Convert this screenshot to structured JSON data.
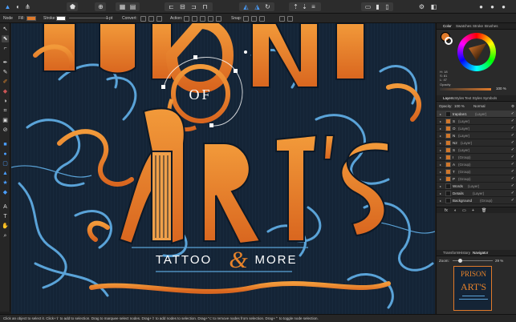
{
  "toolbar": {
    "icons": [
      "affinity-logo-icon",
      "persona-pixel-icon",
      "persona-export-icon",
      "snap-icon",
      "share-icon",
      "grid-icon",
      "arrange-icon",
      "flip-icon",
      "boolean-icon",
      "align-icon",
      "insert-icon",
      "assistant-icon",
      "view-icon",
      "color-icon",
      "studio-icon"
    ]
  },
  "context": {
    "node_label": "Node",
    "fill_label": "Fill:",
    "stroke_label": "Stroke:",
    "stroke_width": "1 pt",
    "convert_label": "Convert:",
    "action_label": "Action:",
    "snap_label": "Snap:",
    "fill_color": "#e07a2a",
    "stroke_color": "#ffffff"
  },
  "tools": [
    "move-tool",
    "node-tool",
    "corner-tool",
    "pen-tool",
    "pencil-tool",
    "vector-brush-tool",
    "fill-tool",
    "transparency-tool",
    "crop-tool",
    "place-image-tool",
    "rectangle-tool",
    "ellipse-tool",
    "rounded-rect-tool",
    "triangle-tool",
    "star-tool",
    "shape-tool",
    "text-tool",
    "frame-text-tool",
    "color-picker-tool",
    "hand-tool",
    "zoom-tool"
  ],
  "artwork": {
    "title_word_1": "PRISON",
    "of_word": "OF",
    "art_word": "ART'S",
    "subtitle_left": "TATTOO",
    "ampersand": "&",
    "subtitle_right": "MORE",
    "accent_orange": "#e8832a",
    "accent_blue": "#5aa3d8",
    "background": "#142436"
  },
  "color_panel": {
    "tabs": [
      "Color",
      "Swatches",
      "Stroke",
      "Brushes"
    ],
    "h": "H: 18",
    "s": "S: 81",
    "l": "L: 47",
    "opacity_label": "Opacity",
    "opacity_value": "100 %"
  },
  "layers_panel": {
    "tabs": [
      "Layers",
      "Styles",
      "Text Styles",
      "Symbols"
    ],
    "opacity": "100 %",
    "blend": "Normal",
    "layers": [
      {
        "name": "trapdan1",
        "kind": "(Layer)",
        "orange": false
      },
      {
        "name": "S",
        "kind": "(Layer)",
        "orange": true
      },
      {
        "name": "O",
        "kind": "(Layer)",
        "orange": true
      },
      {
        "name": "N",
        "kind": "(Layer)",
        "orange": true
      },
      {
        "name": "N2",
        "kind": "(Layer)",
        "orange": true
      },
      {
        "name": "S",
        "kind": "(Layer)",
        "orange": true
      },
      {
        "name": "I",
        "kind": "(Group)",
        "orange": true
      },
      {
        "name": "A",
        "kind": "(Group)",
        "orange": true
      },
      {
        "name": "T",
        "kind": "(Group)",
        "orange": true
      },
      {
        "name": "P",
        "kind": "(Group)",
        "orange": true
      },
      {
        "name": "Words",
        "kind": "(Layer)",
        "orange": false
      },
      {
        "name": "Details",
        "kind": "(Layer)",
        "orange": false
      },
      {
        "name": "Background",
        "kind": "(Group)",
        "orange": false
      }
    ]
  },
  "navigator_panel": {
    "tabs": [
      "Transform",
      "History",
      "Navigator"
    ],
    "zoom_label": "Zoom:",
    "zoom_value": "29 %"
  },
  "status": {
    "text": "Click an object to select it. Click+⇧ to add to selection. Drag to marquee select nodes. Drag+⇧ to add nodes to selection. Drag+⌥ to remove nodes from selection. Drag+⌃ to toggle node selection."
  }
}
